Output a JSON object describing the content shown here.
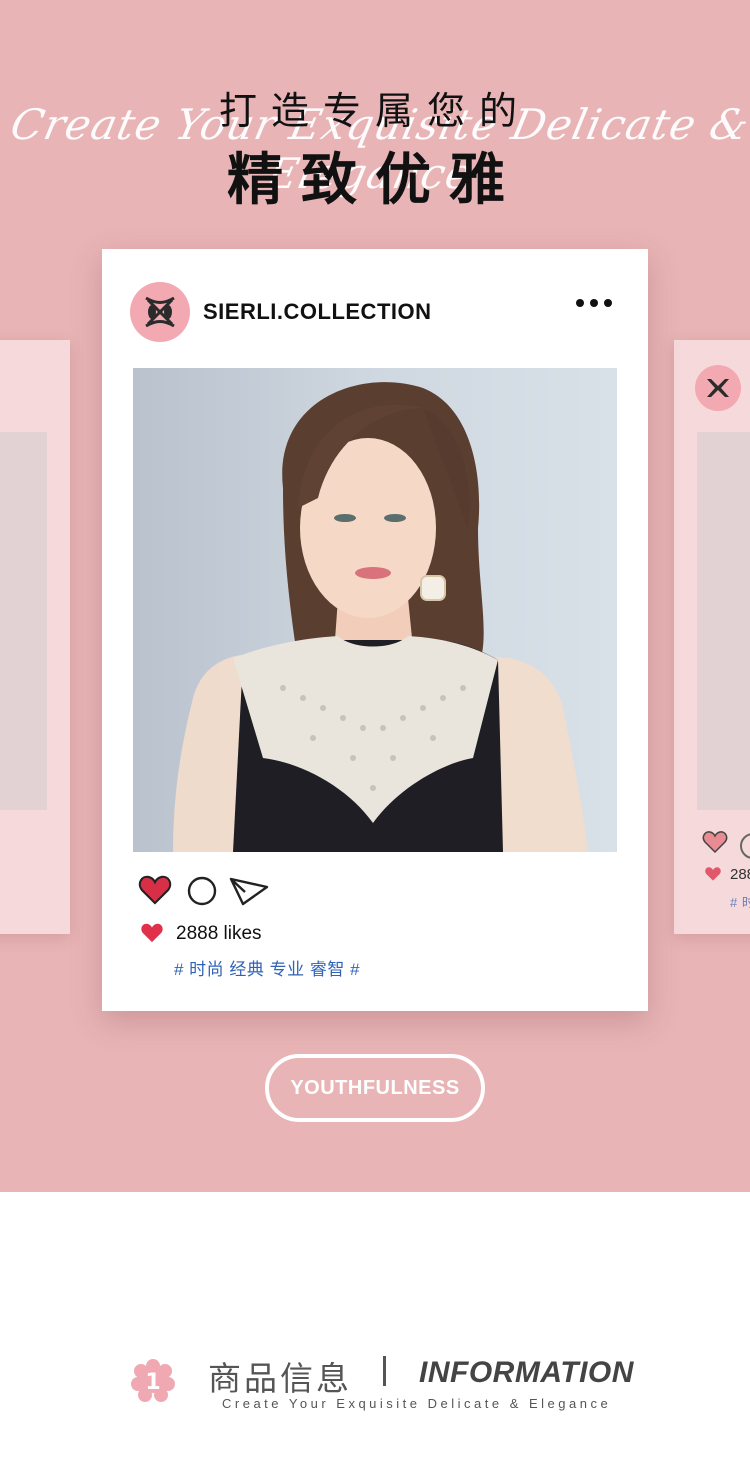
{
  "header": {
    "script_text": "Create Your Exquisite Delicate & Elegance",
    "title_line1": "打造专属您的",
    "title_line2": "精致优雅"
  },
  "post": {
    "account_name": "SIERLI.COLLECTION",
    "likes_text": "2888 likes",
    "hashtags": "# 时尚 经典 专业 睿智 #",
    "accent_color": "#e0304a",
    "tag_color": "#2f63b8"
  },
  "side_card_right": {
    "likes_partial": "288",
    "tags_partial": "# 时"
  },
  "badge": {
    "label": "YOUTHFULNESS"
  },
  "section": {
    "number": "1",
    "title_cn": "商品信息",
    "title_en": "INFORMATION",
    "subtitle": "Create Your Exquisite Delicate & Elegance"
  },
  "colors": {
    "background_pink": "#e8b4b6",
    "card_white": "#ffffff",
    "logo_pink": "#f2a9b1"
  }
}
